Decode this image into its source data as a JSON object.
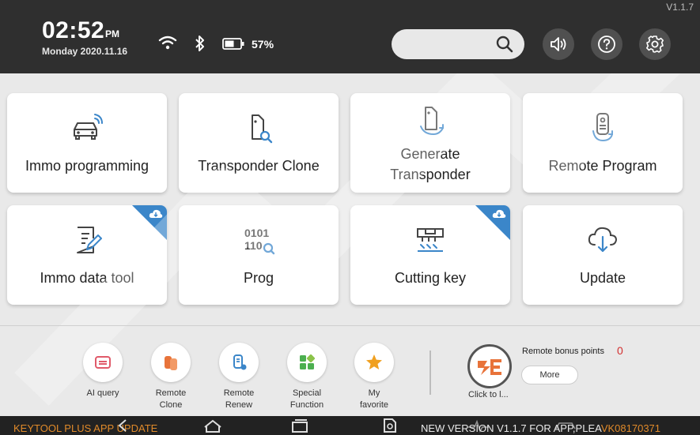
{
  "header": {
    "version": "V1.1.7",
    "time": "02:52",
    "ampm": "PM",
    "date": "Monday 2020.11.16",
    "battery": "57%",
    "icons": [
      "wifi-icon",
      "bluetooth-icon",
      "battery-icon",
      "search-icon",
      "volume-icon",
      "help-icon",
      "settings-icon"
    ]
  },
  "tiles": [
    {
      "label": "Immo programming",
      "icon": "car-key-icon",
      "badge": false
    },
    {
      "label": "Transponder Clone",
      "icon": "transponder-search-icon",
      "badge": false
    },
    {
      "label": "Generate\nTransponder",
      "line1": "Generate",
      "line2": "Transponder",
      "icon": "transponder-generate-icon",
      "badge": false
    },
    {
      "label": "Remote Program",
      "icon": "remote-icon",
      "badge": false
    },
    {
      "label": "Immo data tool",
      "icon": "document-edit-icon",
      "badge": true
    },
    {
      "label": "Prog",
      "icon": "binary-icon",
      "badge": false,
      "icon_text": [
        "0101",
        "110"
      ]
    },
    {
      "label": "Cutting key",
      "icon": "cutting-machine-icon",
      "badge": true
    },
    {
      "label": "Update",
      "icon": "cloud-download-icon",
      "badge": false
    }
  ],
  "bottom": {
    "items": [
      {
        "label": "AI query",
        "icon": "ai-query-icon",
        "color": "#e05a6a"
      },
      {
        "label": "Remote Clone",
        "label1": "Remote",
        "label2": "Clone",
        "icon": "remote-clone-icon",
        "color": "#e8733a"
      },
      {
        "label": "Remote Renew",
        "label1": "Remote",
        "label2": "Renew",
        "icon": "remote-renew-icon",
        "color": "#3b86c9"
      },
      {
        "label": "Special Function",
        "label1": "Special",
        "label2": "Function",
        "icon": "special-function-icon",
        "color": "#4caf50"
      },
      {
        "label": "My favorite",
        "label1": "My",
        "label2": "favorite",
        "icon": "star-icon",
        "color": "#f0a020"
      }
    ],
    "click_label": "Click to l...",
    "bonus_label": "Remote bonus points",
    "bonus_value": "0",
    "more_label": "More"
  },
  "navbar": {
    "ticker_left": "KEYTOOL PLUS APP UPDATE",
    "ticker_right": "NEW VERSION V1.1.7 FOR APP,PLEA",
    "ticker_code": "VK08170371",
    "icons": [
      "back-icon",
      "home-icon",
      "recents-icon",
      "search-doc-icon",
      "pulse-icon",
      "car-icon"
    ]
  },
  "colors": {
    "accent": "#3b86c9",
    "header_bg": "#2f2f2f",
    "ticker": "#e08a2a"
  }
}
